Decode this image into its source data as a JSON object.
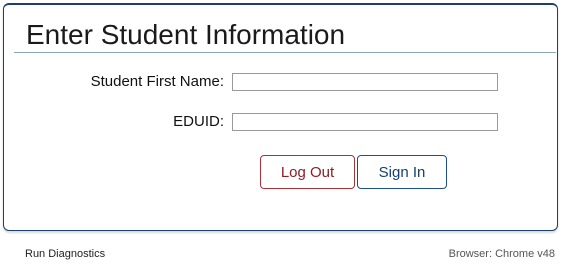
{
  "header": {
    "title": "Enter Student Information"
  },
  "form": {
    "first_name": {
      "label": "Student First Name:",
      "value": "",
      "placeholder": ""
    },
    "eduid": {
      "label": "EDUID:",
      "value": "",
      "placeholder": ""
    }
  },
  "buttons": {
    "logout_label": "Log Out",
    "signin_label": "Sign In"
  },
  "footer": {
    "diagnostics_label": "Run Diagnostics",
    "browser_info": "Browser: Chrome v48"
  },
  "colors": {
    "panel_border": "#1e3f6e",
    "logout_accent": "#a83238",
    "signin_accent": "#1e4f8f"
  }
}
